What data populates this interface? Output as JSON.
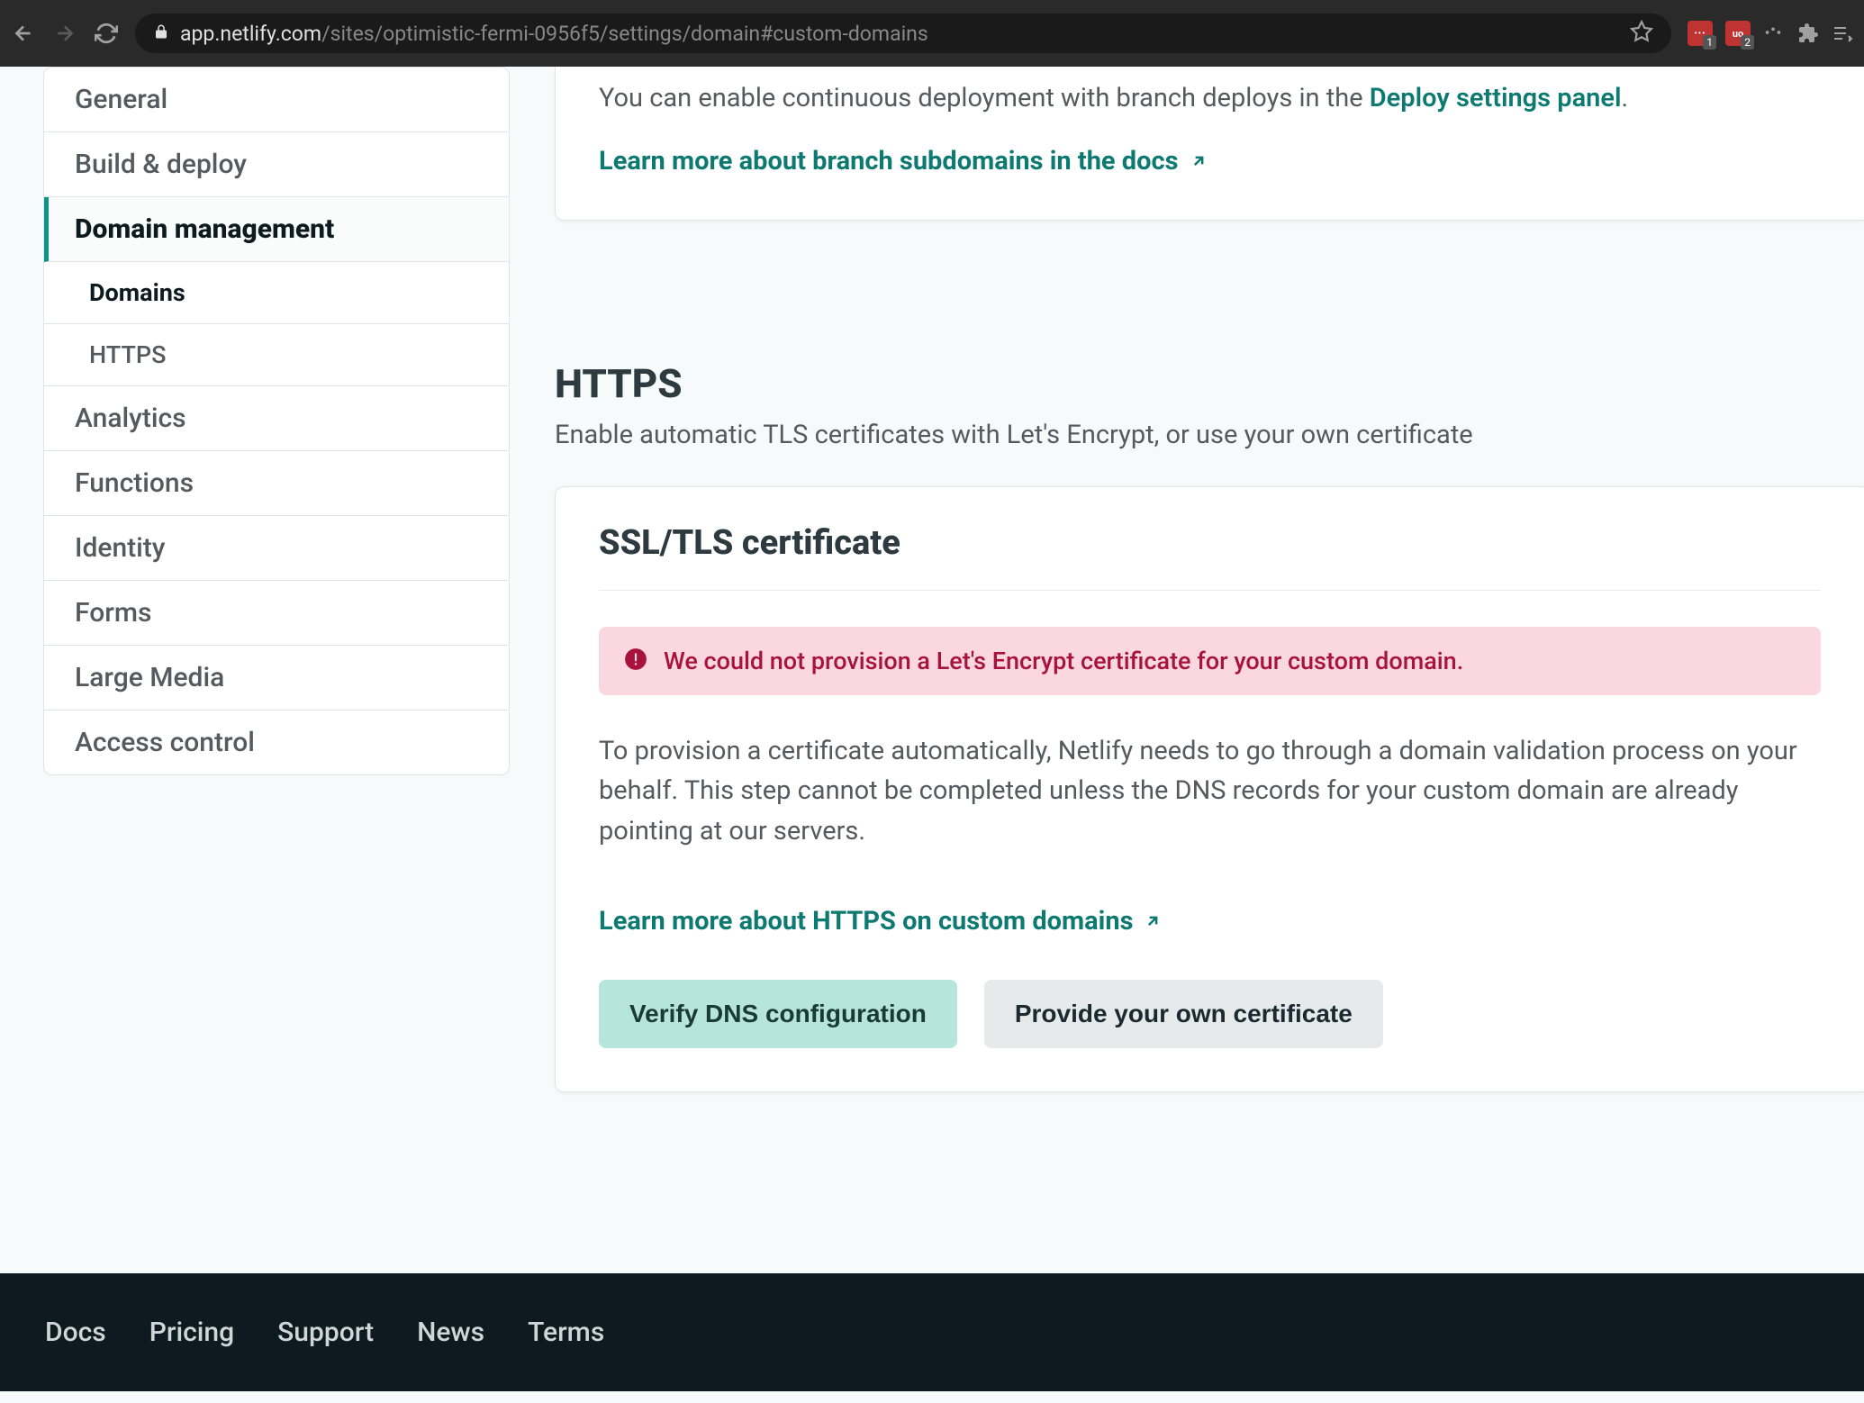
{
  "browser": {
    "url_host": "app.netlify.com",
    "url_path": "/sites/optimistic-fermi-0956f5/settings/domain#custom-domains",
    "ext_badges": [
      "1",
      "2"
    ]
  },
  "sidebar": {
    "items": [
      {
        "label": "General"
      },
      {
        "label": "Build & deploy"
      },
      {
        "label": "Domain management",
        "active": true,
        "subitems": [
          {
            "label": "Domains",
            "active": true
          },
          {
            "label": "HTTPS"
          }
        ]
      },
      {
        "label": "Analytics"
      },
      {
        "label": "Functions"
      },
      {
        "label": "Identity"
      },
      {
        "label": "Forms"
      },
      {
        "label": "Large Media"
      },
      {
        "label": "Access control"
      }
    ]
  },
  "top_section": {
    "intro_prefix": "You can enable continuous deployment with branch deploys in the ",
    "intro_link": "Deploy settings panel",
    "intro_suffix": ".",
    "learn_link": "Learn more about branch subdomains in the docs"
  },
  "https_section": {
    "title": "HTTPS",
    "desc": "Enable automatic TLS certificates with Let's Encrypt, or use your own certificate",
    "card_title": "SSL/TLS certificate",
    "alert_text": "We could not provision a Let's Encrypt certificate for your custom domain.",
    "body": "To provision a certificate automatically, Netlify needs to go through a domain validation process on your behalf. This step cannot be completed unless the DNS records for your custom domain are already pointing at our servers.",
    "learn_link": "Learn more about HTTPS on custom domains",
    "btn_primary": "Verify DNS configuration",
    "btn_secondary": "Provide your own certificate"
  },
  "footer": {
    "links": [
      "Docs",
      "Pricing",
      "Support",
      "News",
      "Terms"
    ]
  }
}
